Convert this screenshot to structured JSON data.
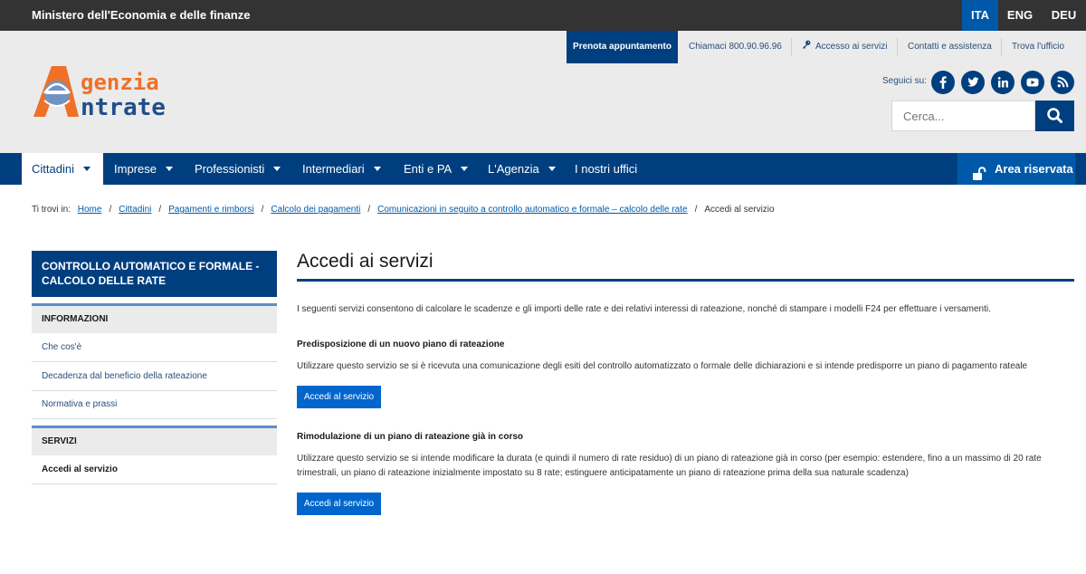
{
  "topbar": {
    "ministry": "Ministero dell'Economia e delle finanze",
    "languages": [
      "ITA",
      "ENG",
      "DEU"
    ],
    "active_language": "ITA"
  },
  "header": {
    "prenota": "Prenota appuntamento",
    "chiamaci": "Chiamaci 800.90.96.96",
    "accesso": "Accesso ai servizi",
    "contatti": "Contatti e assistenza",
    "trova": "Trova l'ufficio",
    "logo_text_1": "genzia",
    "logo_text_2": "ntrate",
    "seguici": "Seguici su:",
    "social": [
      "facebook-icon",
      "twitter-icon",
      "linkedin-icon",
      "youtube-icon",
      "rss-icon"
    ],
    "search_placeholder": "Cerca..."
  },
  "nav": {
    "items": [
      {
        "label": "Cittadini"
      },
      {
        "label": "Imprese"
      },
      {
        "label": "Professionisti"
      },
      {
        "label": "Intermediari"
      },
      {
        "label": "Enti e PA"
      },
      {
        "label": "L'Agenzia"
      },
      {
        "label": "I nostri uffici"
      }
    ],
    "area_riservata": "Area riservata"
  },
  "breadcrumb": {
    "prefix": "Ti trovi in:",
    "links": [
      "Home",
      "Cittadini",
      "Pagamenti e rimborsi",
      "Calcolo dei pagamenti",
      "Comunicazioni in seguito a controllo automatico e formale – calcolo delle rate"
    ],
    "current": "Accedi al servizio"
  },
  "sidebar": {
    "title": "CONTROLLO AUTOMATICO E FORMALE - CALCOLO DELLE RATE",
    "informazioni": "INFORMAZIONI",
    "info_links": [
      "Che cos'è",
      "Decadenza dal beneficio della rateazione",
      "Normativa e prassi"
    ],
    "servizi": "SERVIZI",
    "servizi_links": [
      "Accedi al servizio"
    ]
  },
  "main": {
    "title": "Accedi ai servizi",
    "intro": "I seguenti servizi consentono di calcolare le scadenze e gli importi delle rate e dei relativi interessi di rateazione, nonché di stampare i modelli F24 per effettuare i versamenti.",
    "section1_title": "Predisposizione di un nuovo piano di rateazione",
    "section1_text": "Utilizzare questo servizio se si è ricevuta una comunicazione degli esiti del controllo automatizzato o formale delle dichiarazioni e si intende predisporre un piano di pagamento rateale",
    "section2_title": "Rimodulazione di un piano di rateazione già in corso",
    "section2_text": "Utilizzare questo servizio se si intende modificare la durata (e quindi il numero di rate residuo) di un piano di rateazione già in corso (per esempio: estendere, fino a un massimo di 20 rate trimestrali, un piano di rateazione inizialmente impostato su 8 rate; estinguere anticipatamente un piano di rateazione prima della sua naturale scadenza)",
    "button_label": "Accedi al servizio"
  },
  "colors": {
    "brand_blue": "#003f7f",
    "accent_blue": "#0059a8",
    "button_blue": "#0066cc",
    "logo_orange": "#ee7127"
  }
}
